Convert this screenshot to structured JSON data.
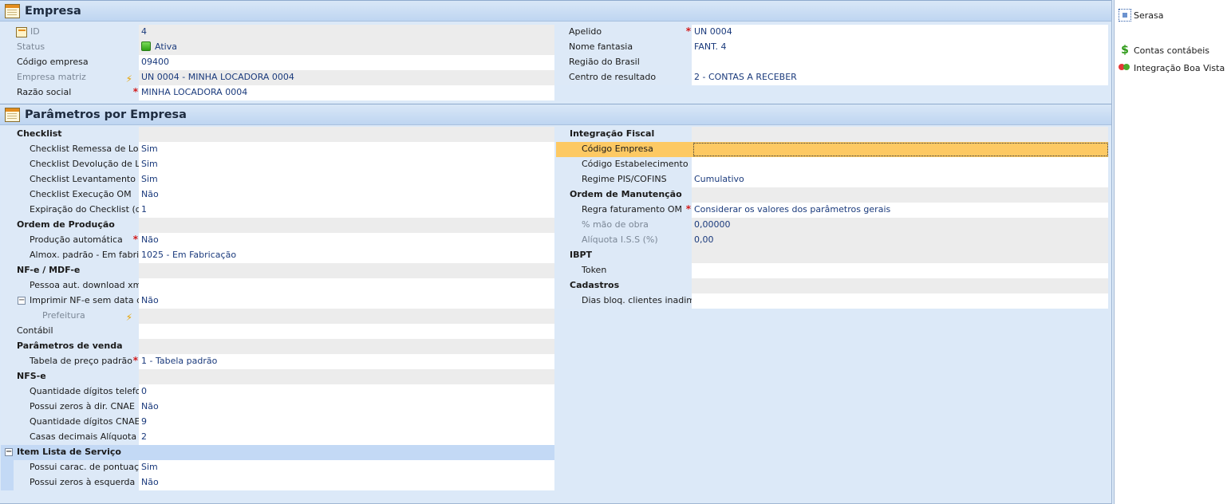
{
  "empresa": {
    "title": "Empresa",
    "left": [
      {
        "label": "ID",
        "value": "4",
        "icon": "id-card-icon"
      },
      {
        "label": "Status",
        "value": "Ativa",
        "status_color": "#2ea115"
      },
      {
        "label": "Código empresa",
        "value": "09400"
      },
      {
        "label": "Empresa matriz",
        "value": "UN 0004 - MINHA LOCADORA 0004"
      },
      {
        "label": "Razão social",
        "value": "MINHA LOCADORA 0004"
      }
    ],
    "right": [
      {
        "label": "Apelido",
        "value": "UN 0004"
      },
      {
        "label": "Nome fantasia",
        "value": "FANT. 4"
      },
      {
        "label": "Região do Brasil",
        "value": ""
      },
      {
        "label": "Centro de resultado",
        "value": "2 - CONTAS A RECEBER"
      }
    ]
  },
  "parametros": {
    "title": "Parâmetros por Empresa",
    "left": {
      "checklist": "Checklist",
      "checklist_remessa": {
        "label": "Checklist Remessa de Locação",
        "value": "Sim"
      },
      "checklist_devolucao": {
        "label": "Checklist Devolução de Locação",
        "value": "Sim"
      },
      "checklist_levantamento": {
        "label": "Checklist Levantamento OM",
        "value": "Sim"
      },
      "checklist_execucao": {
        "label": "Checklist Execução OM",
        "value": "Não"
      },
      "expiracao": {
        "label": "Expiração do Checklist (dias)",
        "value": "1"
      },
      "ordem_producao": "Ordem de Produção",
      "producao_auto": {
        "label": "Produção automática",
        "value": "Não"
      },
      "almox": {
        "label": "Almox. padrão - Em fabricação",
        "value": "1025 - Em Fabricação"
      },
      "nfe": "NF-e / MDF-e",
      "pessoa_xml": {
        "label": "Pessoa aut. download xml",
        "value": ""
      },
      "imprimir_nfe": {
        "label": "Imprimir NF-e sem data de Emissão",
        "value": "Não"
      },
      "prefeitura": {
        "label": "Prefeitura",
        "value": ""
      },
      "contabil": {
        "label": "Contábil",
        "value": ""
      },
      "param_venda": "Parâmetros de venda",
      "tabela_preco": {
        "label": "Tabela de preço padrão",
        "value": "1 - Tabela padrão"
      },
      "nfse": "NFS-e",
      "qtd_tel": {
        "label": "Quantidade dígitos telefone",
        "value": "0"
      },
      "zeros_cnae": {
        "label": "Possui zeros à dir. CNAE",
        "value": "Não"
      },
      "qtd_cnae": {
        "label": "Quantidade dígitos CNAE",
        "value": "9"
      },
      "casas_iss": {
        "label": "Casas decimais Alíquota ISS",
        "value": "2"
      },
      "item_lista": "Item Lista de Serviço",
      "carac_pont": {
        "label": "Possui carac. de pontuação",
        "value": "Sim"
      },
      "zeros_esq": {
        "label": "Possui zeros à esquerda",
        "value": "Não"
      }
    },
    "right": {
      "integracao_fiscal": "Integração Fiscal",
      "codigo_empresa": {
        "label": "Código Empresa",
        "value": ""
      },
      "codigo_estab": {
        "label": "Código Estabelecimento",
        "value": ""
      },
      "regime": {
        "label": "Regime PIS/COFINS",
        "value": "Cumulativo"
      },
      "ordem_manut": "Ordem de Manutenção",
      "regra_fat": {
        "label": "Regra faturamento OM",
        "value": "Considerar os valores dos parâmetros gerais"
      },
      "mao_obra": {
        "label": "% mão de obra",
        "value": "0,00000"
      },
      "aliquota_iss": {
        "label": "Alíquota I.S.S (%)",
        "value": "0,00"
      },
      "ibpt": "IBPT",
      "token": {
        "label": "Token",
        "value": ""
      },
      "cadastros": "Cadastros",
      "dias_bloq": {
        "label": "Dias bloq. clientes inadimplentes",
        "value": ""
      }
    }
  },
  "side": {
    "serasa": "Serasa",
    "contas": "Contas contábeis",
    "boa_vista": "Integração Boa Vista"
  },
  "colors": {
    "panel_bg": "#dce9f8",
    "selected": "#fdc963",
    "value_text": "#1a3a7c",
    "required": "#d31a1a"
  }
}
